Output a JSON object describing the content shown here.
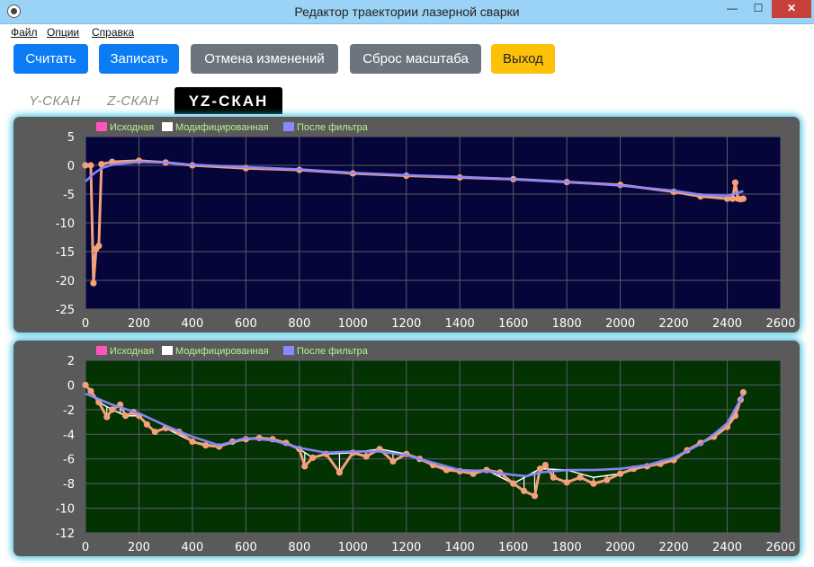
{
  "window": {
    "title": "Редактор траектории лазерной сварки",
    "minimize": "—",
    "maximize": "☐",
    "close": "✕"
  },
  "menu": [
    "Файл",
    "Опции",
    "Справка"
  ],
  "toolbar": {
    "read": "Считать",
    "write": "Записать",
    "undo": "Отмена изменений",
    "reset_zoom": "Сброс масштаба",
    "exit": "Выход"
  },
  "tabs": [
    "Y-СКАН",
    "Z-СКАН",
    "YZ-СКАН"
  ],
  "active_tab": "YZ-СКАН",
  "colors": {
    "orig": "#ff55bb",
    "mod": "#ffffff",
    "filt": "#8888ff",
    "points": "#f4a07a",
    "bg_top": "#05053a",
    "bg_bottom": "#033303",
    "legend_text": "#b6f28a"
  },
  "chart_data": [
    {
      "type": "line",
      "legend": [
        "Исходная",
        "Модифицированная",
        "После фильтра"
      ],
      "xlim": [
        0,
        2600
      ],
      "ylim": [
        -25,
        5
      ],
      "xticks": [
        0,
        200,
        400,
        600,
        800,
        1000,
        1200,
        1400,
        1600,
        1800,
        2000,
        2200,
        2400,
        2600
      ],
      "yticks": [
        5,
        0,
        -5,
        -10,
        -15,
        -20,
        -25
      ],
      "series": [
        {
          "name": "Исходная",
          "x": [
            0,
            20,
            30,
            40,
            50,
            60,
            100,
            200,
            300,
            400,
            600,
            800,
            1000,
            1200,
            1400,
            1600,
            1800,
            2000,
            2200,
            2300,
            2400,
            2420,
            2430,
            2440,
            2450,
            2460
          ],
          "y": [
            0,
            0,
            -20.5,
            -14.5,
            -14,
            0.2,
            0.6,
            0.8,
            0.5,
            0,
            -0.5,
            -0.8,
            -1.4,
            -1.8,
            -2.1,
            -2.4,
            -2.9,
            -3.4,
            -4.6,
            -5.4,
            -5.8,
            -5.8,
            -3,
            -5.8,
            -5.9,
            -5.8
          ]
        },
        {
          "name": "Модифицированная",
          "x": [
            0,
            20,
            30,
            40,
            50,
            60,
            100,
            200,
            300,
            400,
            600,
            800,
            1000,
            1200,
            1400,
            1600,
            1800,
            2000,
            2200,
            2300,
            2400,
            2420,
            2430,
            2440,
            2450,
            2460
          ],
          "y": [
            0,
            0,
            -20.5,
            -14.5,
            -14,
            0.2,
            0.6,
            0.8,
            0.5,
            0,
            -0.5,
            -0.8,
            -1.4,
            -1.8,
            -2.1,
            -2.4,
            -2.9,
            -3.4,
            -4.6,
            -5.4,
            -5.8,
            -5.8,
            -3,
            -5.8,
            -5.9,
            -5.8
          ]
        },
        {
          "name": "После фильтра",
          "x": [
            0,
            30,
            60,
            100,
            200,
            300,
            400,
            600,
            800,
            1000,
            1200,
            1400,
            1600,
            1800,
            2000,
            2200,
            2300,
            2400,
            2460
          ],
          "y": [
            -2.8,
            -1.5,
            -0.5,
            0.1,
            0.6,
            0.5,
            0.1,
            -0.3,
            -0.7,
            -1.3,
            -1.7,
            -2,
            -2.4,
            -2.9,
            -3.5,
            -4.4,
            -5.1,
            -5.3,
            -4.5
          ]
        }
      ]
    },
    {
      "type": "line",
      "legend": [
        "Исходная",
        "Модифицированная",
        "После фильтра"
      ],
      "xlim": [
        0,
        2600
      ],
      "ylim": [
        -12,
        2
      ],
      "xticks": [
        0,
        200,
        400,
        600,
        800,
        1000,
        1200,
        1400,
        1600,
        1800,
        2000,
        2200,
        2400,
        2600
      ],
      "yticks": [
        2,
        0,
        -2,
        -4,
        -6,
        -8,
        -10,
        -12
      ],
      "series": [
        {
          "name": "Исходная",
          "x": [
            0,
            20,
            50,
            80,
            100,
            130,
            150,
            180,
            200,
            230,
            260,
            300,
            350,
            400,
            450,
            500,
            550,
            600,
            650,
            700,
            750,
            800,
            820,
            850,
            900,
            950,
            1000,
            1050,
            1100,
            1150,
            1200,
            1250,
            1300,
            1350,
            1400,
            1450,
            1500,
            1550,
            1600,
            1640,
            1680,
            1700,
            1720,
            1750,
            1800,
            1850,
            1900,
            1950,
            2000,
            2050,
            2100,
            2150,
            2200,
            2250,
            2300,
            2350,
            2400,
            2430,
            2450,
            2460
          ],
          "y": [
            0,
            -0.5,
            -1.4,
            -2.6,
            -2,
            -1.6,
            -2.5,
            -2.2,
            -2.5,
            -3.2,
            -3.8,
            -3.5,
            -3.8,
            -4.6,
            -4.9,
            -5,
            -4.6,
            -4.4,
            -4.3,
            -4.4,
            -4.7,
            -5.2,
            -6.6,
            -5.9,
            -5.6,
            -7.1,
            -5.5,
            -5.8,
            -5.2,
            -6.2,
            -5.6,
            -6,
            -6.5,
            -6.9,
            -7,
            -7.2,
            -6.9,
            -7.1,
            -8,
            -8.6,
            -9,
            -6.8,
            -6.5,
            -7.5,
            -7.9,
            -7.5,
            -8,
            -7.7,
            -7.2,
            -6.8,
            -6.6,
            -6.4,
            -6.1,
            -5.3,
            -4.7,
            -4.2,
            -3.4,
            -2.5,
            -1.2,
            -0.6
          ]
        },
        {
          "name": "Модифицированная",
          "x": [
            0,
            50,
            100,
            150,
            200,
            260,
            300,
            400,
            500,
            600,
            700,
            800,
            850,
            900,
            1000,
            1100,
            1200,
            1300,
            1400,
            1500,
            1600,
            1700,
            1800,
            1900,
            2000,
            2100,
            2200,
            2300,
            2400,
            2460
          ],
          "y": [
            0,
            -1.4,
            -2,
            -2.5,
            -2.5,
            -3.8,
            -3.5,
            -4.6,
            -5,
            -4.4,
            -4.4,
            -5.2,
            -5.9,
            -5.6,
            -5.5,
            -5.2,
            -5.6,
            -6.5,
            -7,
            -6.9,
            -8,
            -6.8,
            -6.9,
            -7.5,
            -7.2,
            -6.6,
            -6.1,
            -4.7,
            -3.4,
            -0.6
          ]
        },
        {
          "name": "После фильтра",
          "x": [
            0,
            100,
            200,
            300,
            400,
            500,
            600,
            700,
            800,
            900,
            1000,
            1100,
            1200,
            1300,
            1400,
            1500,
            1600,
            1650,
            1700,
            1800,
            1900,
            2000,
            2100,
            2200,
            2300,
            2350,
            2400,
            2460
          ],
          "y": [
            -0.7,
            -1.6,
            -2.3,
            -3.3,
            -4.2,
            -4.9,
            -4.3,
            -4.5,
            -5.1,
            -5.5,
            -5.4,
            -5.4,
            -5.7,
            -6.3,
            -6.9,
            -7,
            -7.3,
            -7.4,
            -7.1,
            -6.9,
            -6.9,
            -6.8,
            -6.5,
            -5.9,
            -4.8,
            -4,
            -3.1,
            -0.8
          ]
        }
      ]
    }
  ]
}
